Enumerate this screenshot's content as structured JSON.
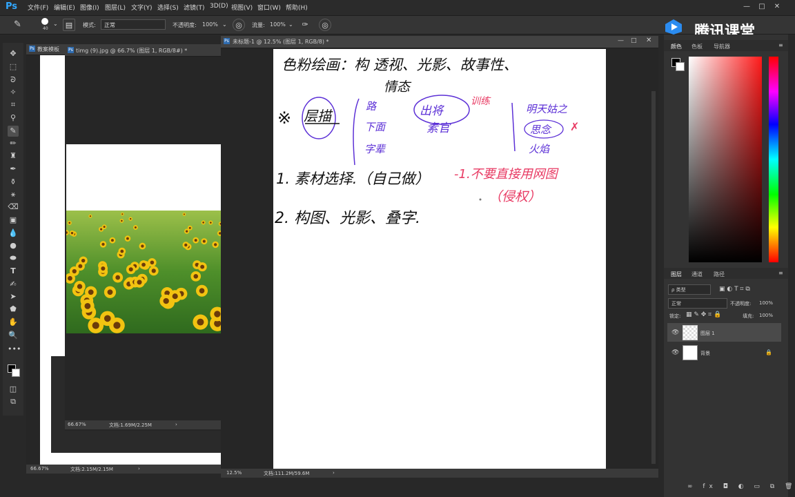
{
  "menubar": {
    "logo": "Ps",
    "items": [
      "文件(F)",
      "编辑(E)",
      "图像(I)",
      "图层(L)",
      "文字(Y)",
      "选择(S)",
      "滤镜(T)",
      "3D(D)",
      "视图(V)",
      "窗口(W)",
      "帮助(H)"
    ],
    "win_buttons": [
      "—",
      "□",
      "✕"
    ]
  },
  "options": {
    "brush_size": "40",
    "mode_label": "模式:",
    "mode_value": "正常",
    "opacity_label": "不透明度:",
    "opacity_value": "100%",
    "flow_label": "流量:",
    "flow_value": "100%"
  },
  "watermark": {
    "text": "腾讯课堂"
  },
  "docs": {
    "back_doc": {
      "tab": "教案模板",
      "zoom": "66.67%",
      "status": "文档:2.15M/2.15M"
    },
    "sunflower_doc": {
      "tab": "timg (9).jpg @ 66.7% (图层 1, RGB/8#) *",
      "zoom": "66.67%",
      "status": "文档:1.69M/2.25M"
    },
    "main_doc": {
      "tab": "未标题-1 @ 12.5% (图层 1, RGB/8) *",
      "zoom": "12.5%",
      "status": "文档:111.2M/59.6M"
    }
  },
  "handwriting": {
    "line1": "色粉绘画：构  透视、光影、故事性、",
    "line1b": "情态",
    "circle_word": "层描",
    "bracket1": [
      "路",
      "下面",
      "字辈"
    ],
    "circle2": "出将",
    "circle2b": "素官",
    "note_red": "训练",
    "right_col": [
      "明天姑之",
      "思念",
      "火焰"
    ],
    "item1": "1. 素材选择.（自己做）",
    "item1_red": "-1.不要直接用网图",
    "item1_red2": "（侵权）",
    "item2": "2. 构图、光影、叠字."
  },
  "panels": {
    "top_tabs": [
      "颜色",
      "色板",
      "导航器"
    ],
    "layer_tabs": [
      "图层",
      "通道",
      "路径"
    ],
    "kind_label": "ρ 类型",
    "blend_mode": "正常",
    "opacity_label": "不透明度:",
    "opacity_value": "100%",
    "lock_label": "锁定:",
    "fill_label": "填充:",
    "fill_value": "100%",
    "layers": [
      {
        "name": "图层 1",
        "selected": true
      },
      {
        "name": "背景",
        "selected": false
      }
    ]
  },
  "colors": {
    "accent": "#31a8ff",
    "ink_black": "#111111",
    "ink_purple": "#5b2fd6",
    "ink_red": "#e83a63"
  }
}
